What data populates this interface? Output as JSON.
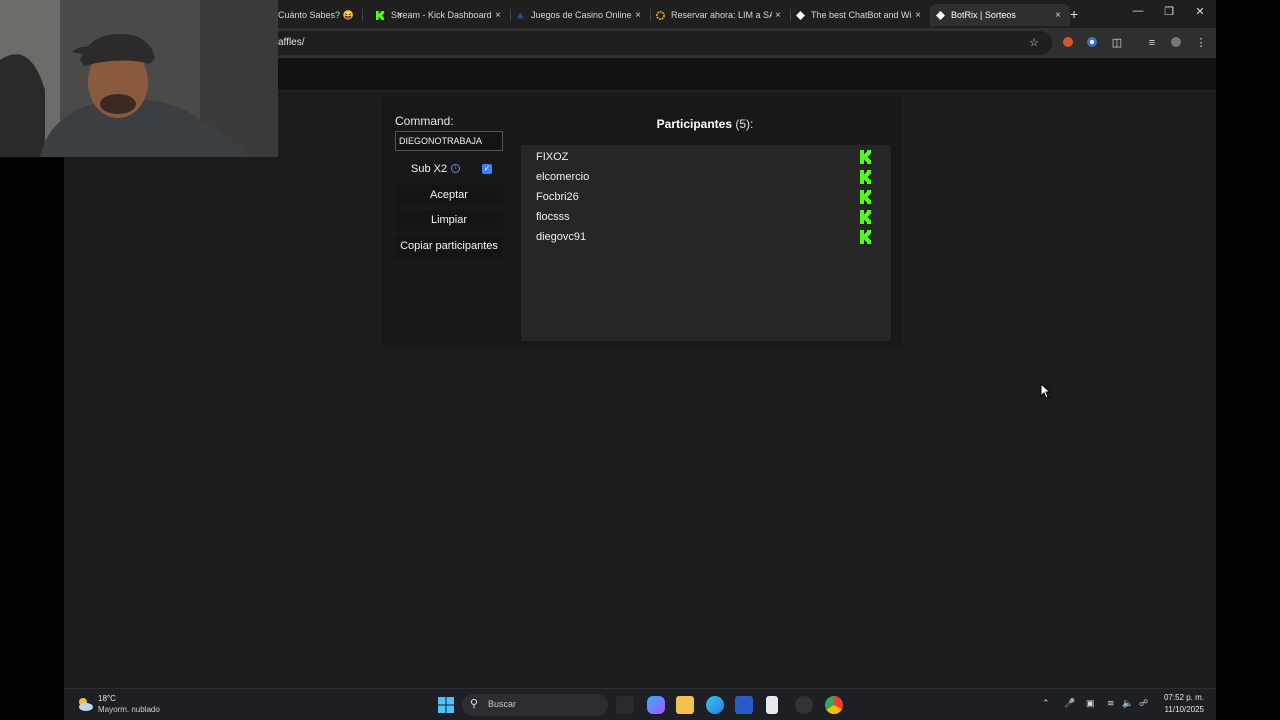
{
  "browser": {
    "tabs": [
      {
        "label": "Cuánto Sabes? 😝",
        "icon": "tab-favicon",
        "active": false
      },
      {
        "label": "Stream - Kick Dashboard",
        "icon": "kick-icon",
        "active": false
      },
      {
        "label": "Juegos de Casino Online |",
        "icon": "casino-icon",
        "active": false
      },
      {
        "label": "Reservar ahora: LIM a SAI",
        "icon": "booking-icon",
        "active": false
      },
      {
        "label": "The best ChatBot and Wi",
        "icon": "botrix-icon",
        "active": false
      },
      {
        "label": "BotRix | Sorteos",
        "icon": "botrix-icon",
        "active": true
      }
    ],
    "close_glyph": "×",
    "new_tab_glyph": "+",
    "url": "affles/"
  },
  "raffle": {
    "command_label": "Command:",
    "command_value": "DIEGONOTRABAJA",
    "sub_x2_label": "Sub X2",
    "sub_x2_checked": true,
    "accept_label": "Aceptar",
    "clear_label": "Limpiar",
    "copy_label": "Copiar participantes",
    "participants_title": "Participantes",
    "participants_count": "(5):",
    "participants": [
      {
        "name": "FIXOZ",
        "platform_icon": "kick-icon"
      },
      {
        "name": "elcomercio",
        "platform_icon": "kick-icon"
      },
      {
        "name": "Focbri26",
        "platform_icon": "kick-icon"
      },
      {
        "name": "flocsss",
        "platform_icon": "kick-icon"
      },
      {
        "name": "diegovc91",
        "platform_icon": "kick-icon"
      }
    ],
    "kick_color": "#53fc18"
  },
  "taskbar": {
    "weather_temp": "18°C",
    "weather_desc": "Mayorm. nublado",
    "search_placeholder": "Buscar",
    "time": "07:52 p. m.",
    "date": "11/10/2025"
  }
}
